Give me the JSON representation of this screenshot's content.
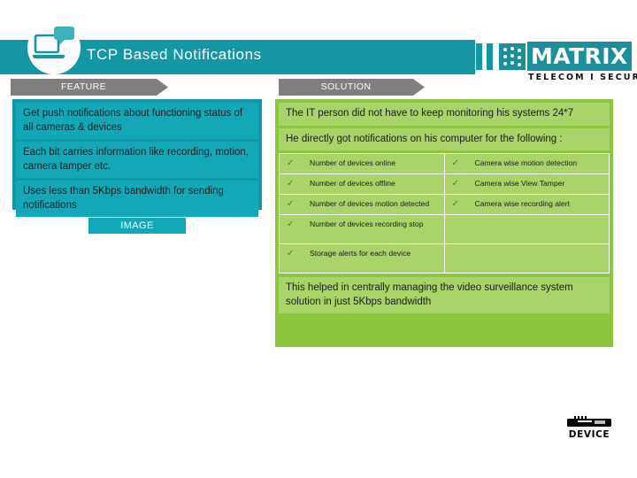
{
  "header": {
    "title": "TCP Based Notifications",
    "brand_icon": "laptop-chat-icon",
    "accent_teal": "#1496a5",
    "accent_green": "#8cc63e"
  },
  "logo": {
    "name": "MATRIX",
    "tagline": "TELECOM I SECURITY"
  },
  "tabs": {
    "feature_label": "FEATURE",
    "solution_label": "SOLUTION"
  },
  "feature": {
    "items": [
      "Get push notifications about functioning status of all cameras & devices",
      "Each bit carries information like recording, motion, camera tamper etc.",
      "Uses less than 5Kbps bandwidth for sending notifications"
    ],
    "image_placeholder": "IMAGE"
  },
  "solution": {
    "items": [
      "The IT person did not have to keep monitoring his systems 24*7",
      "He directly got notifications on his computer for the following :"
    ],
    "checklist": {
      "check_glyph": "✓",
      "rows": [
        {
          "left": "Number of devices online",
          "right": "Camera wise motion detection"
        },
        {
          "left": "Number of devices offline",
          "right": "Camera  wise View Tamper"
        },
        {
          "left": "Number of  devices motion detected",
          "right": "Camera wise recording alert"
        },
        {
          "left": "Number of devices recording stop",
          "right": ""
        },
        {
          "left": "Storage alerts for each device",
          "right": ""
        }
      ]
    },
    "closing_note": "This helped in centrally managing the video surveillance system solution in just 5Kbps bandwidth"
  },
  "footer": {
    "device_label": "DEVICE",
    "device_icon": "server-rack-icon"
  }
}
